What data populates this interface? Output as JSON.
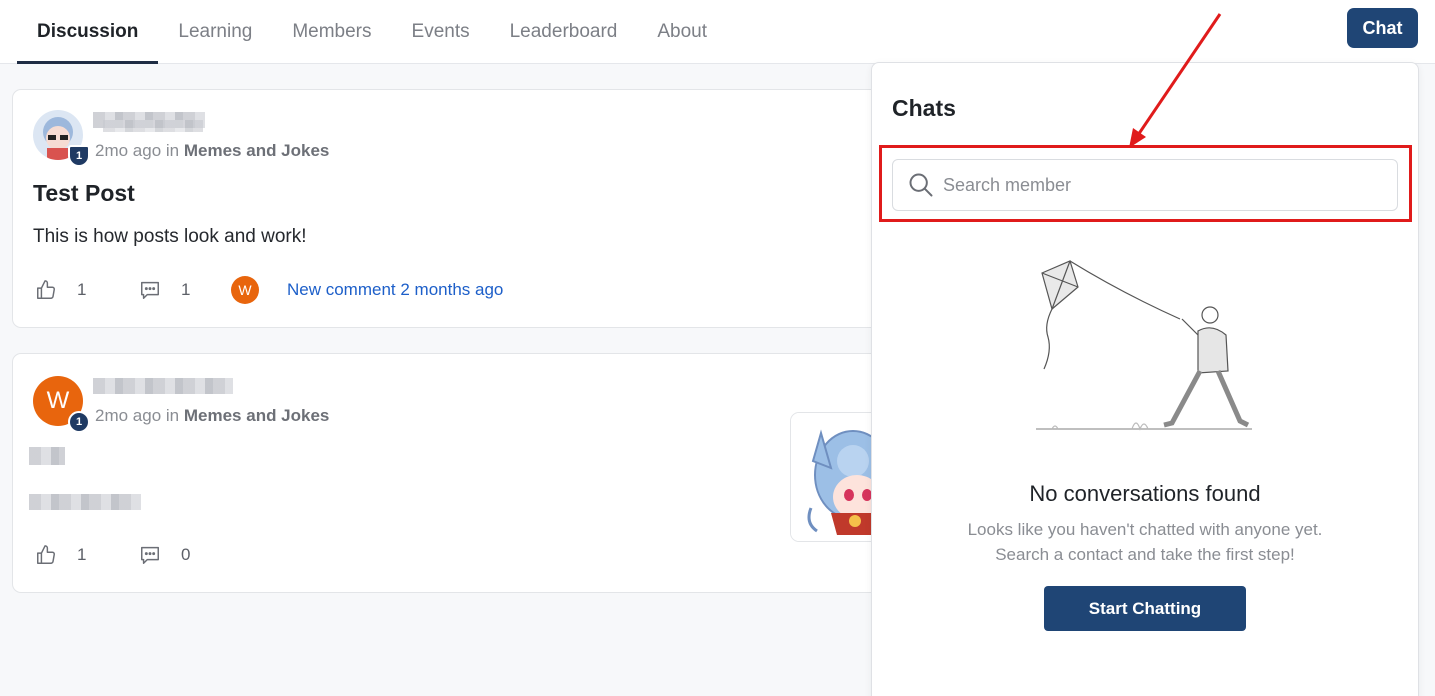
{
  "nav": {
    "tabs": [
      "Discussion",
      "Learning",
      "Members",
      "Events",
      "Leaderboard",
      "About"
    ],
    "active_tab": "Discussion",
    "chat_button": "Chat"
  },
  "posts": [
    {
      "time": "2mo ago",
      "in_word": "in",
      "category": "Memes and Jokes",
      "level": "1",
      "title": "Test Post",
      "body": "This is how posts look and work!",
      "likes": "1",
      "comments": "1",
      "commenter_initial": "W",
      "new_comment": "New comment 2 months ago"
    },
    {
      "time": "2mo ago",
      "in_word": "in",
      "category": "Memes and Jokes",
      "level": "1",
      "author_initial": "W",
      "likes": "1",
      "comments": "0"
    }
  ],
  "chat_panel": {
    "title": "Chats",
    "search_placeholder": "Search member",
    "empty_title": "No conversations found",
    "empty_line1": "Looks like you haven't chatted with anyone yet.",
    "empty_line2": "Search a contact and take the first step!",
    "start_button": "Start Chatting"
  },
  "colors": {
    "primary": "#1f4575",
    "avatar_orange": "#e8650d",
    "link_blue": "#1d5fc9",
    "annotation_red": "#e01b1b"
  }
}
